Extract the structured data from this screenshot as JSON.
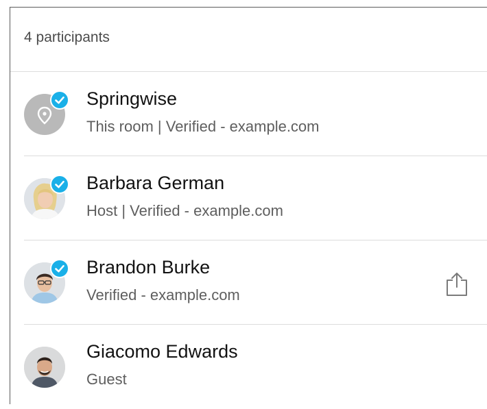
{
  "header": {
    "participants_count": "4 participants"
  },
  "participants": [
    {
      "name": "Springwise",
      "subtitle": "This room | Verified - example.com",
      "verified": true,
      "avatar": "room-location-icon"
    },
    {
      "name": "Barbara German",
      "subtitle": "Host | Verified - example.com",
      "verified": true,
      "avatar": "photo"
    },
    {
      "name": "Brandon Burke",
      "subtitle": "Verified - example.com",
      "verified": true,
      "avatar": "photo",
      "action": "share-icon"
    },
    {
      "name": "Giacomo Edwards",
      "subtitle": "Guest",
      "verified": false,
      "avatar": "photo"
    }
  ],
  "colors": {
    "verified_badge": "#1ab0e8",
    "divider": "#dcdcdc",
    "name_text": "#121212",
    "subtitle_text": "#5e5e5e"
  }
}
